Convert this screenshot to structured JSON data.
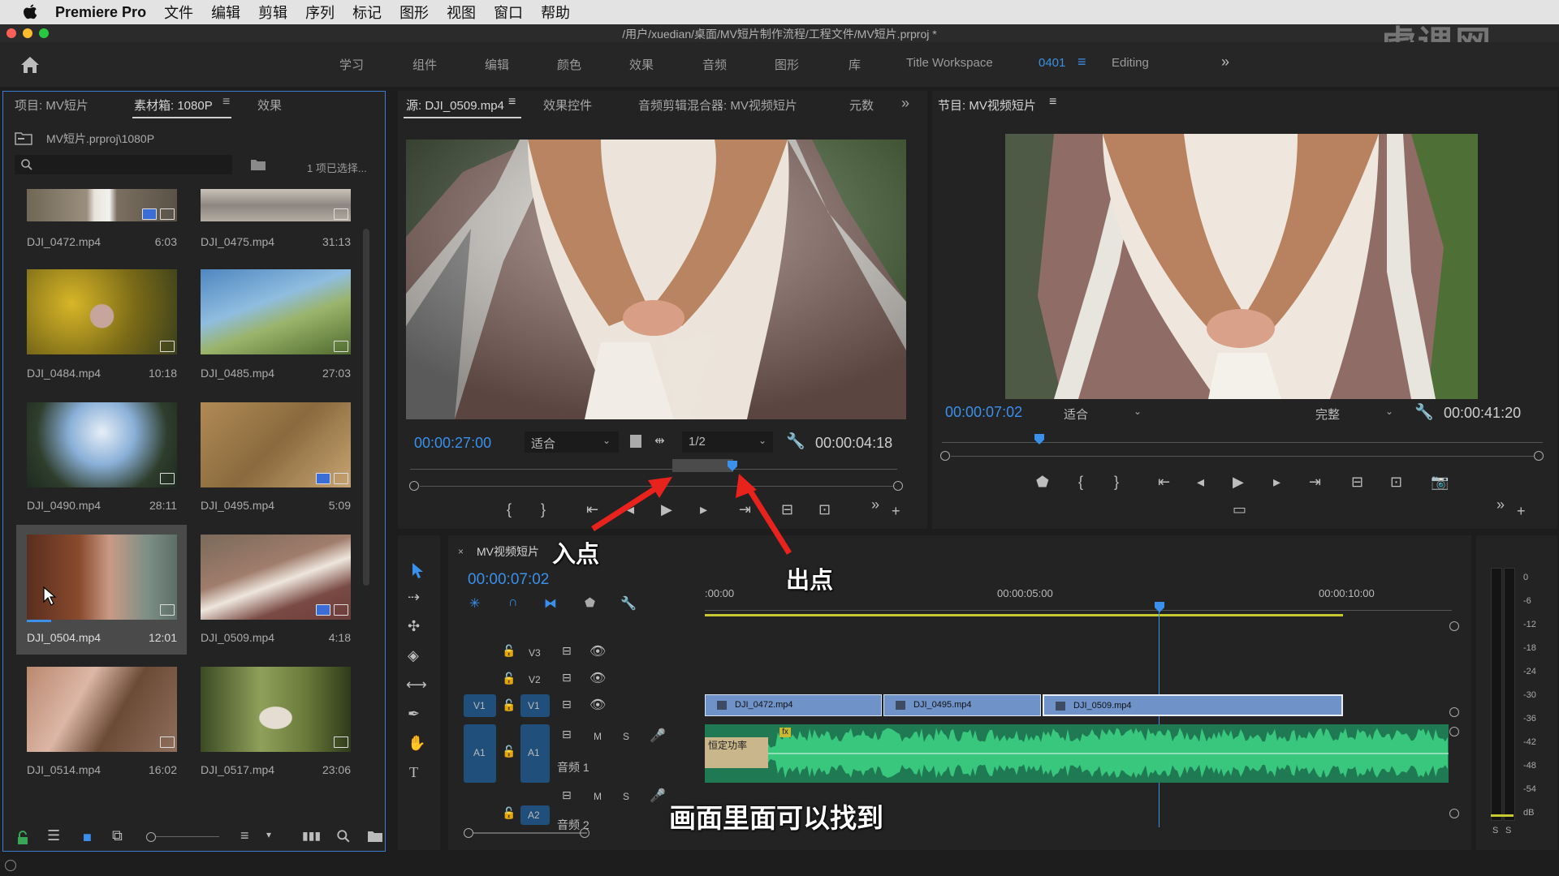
{
  "menubar": {
    "app": "Premiere Pro",
    "items": [
      "文件",
      "编辑",
      "剪辑",
      "序列",
      "标记",
      "图形",
      "视图",
      "窗口",
      "帮助"
    ]
  },
  "window": {
    "title": "/用户/xuedian/桌面/MV短片制作流程/工程文件/MV短片.prproj *"
  },
  "watermark": "虎课网",
  "workspaces": {
    "items": [
      "学习",
      "组件",
      "编辑",
      "颜色",
      "效果",
      "音频",
      "图形",
      "库",
      "Title Workspace"
    ],
    "active": "0401",
    "editing": "Editing",
    "more": "»"
  },
  "project": {
    "tabs": [
      "项目: MV短片",
      "素材箱: 1080P",
      "效果"
    ],
    "path": "MV短片.prproj\\1080P",
    "selection": "1 项已选择...",
    "items": [
      {
        "name": "DJI_0472.mp4",
        "duration": "6:03"
      },
      {
        "name": "DJI_0475.mp4",
        "duration": "31:13"
      },
      {
        "name": "DJI_0484.mp4",
        "duration": "10:18"
      },
      {
        "name": "DJI_0485.mp4",
        "duration": "27:03"
      },
      {
        "name": "DJI_0490.mp4",
        "duration": "28:11"
      },
      {
        "name": "DJI_0495.mp4",
        "duration": "5:09"
      },
      {
        "name": "DJI_0504.mp4",
        "duration": "12:01"
      },
      {
        "name": "DJI_0509.mp4",
        "duration": "4:18"
      },
      {
        "name": "DJI_0514.mp4",
        "duration": "16:02"
      },
      {
        "name": "DJI_0517.mp4",
        "duration": "23:06"
      }
    ]
  },
  "source": {
    "tabs": [
      "源: DJI_0509.mp4",
      "效果控件",
      "音频剪辑混合器: MV视频短片",
      "元数"
    ],
    "timecode": "00:00:27:00",
    "fit": "适合",
    "resolution": "1/2",
    "duration": "00:00:04:18"
  },
  "program": {
    "tab": "节目: MV视频短片",
    "timecode": "00:00:07:02",
    "fit": "适合",
    "quality": "完整",
    "duration": "00:00:41:20"
  },
  "timeline": {
    "sequence": "MV视频短片",
    "timecode": "00:00:07:02",
    "ruler": [
      ":00:00",
      "00:00:05:00",
      "00:00:10:00"
    ],
    "tracks": {
      "v3": "V3",
      "v2": "V2",
      "v1": "V1",
      "a1": "A1",
      "a2": "A2",
      "a1_name": "音频 1",
      "a2_name": "音频 2",
      "m": "M",
      "s": "S"
    },
    "clips": [
      "DJI_0472.mp4",
      "DJI_0495.mp4",
      "DJI_0509.mp4"
    ],
    "transition": "恒定功率",
    "fx": "fx"
  },
  "meter": {
    "labels": [
      "0",
      "-6",
      "-12",
      "-18",
      "-24",
      "-30",
      "-36",
      "-42",
      "-48",
      "-54",
      "dB"
    ],
    "solo": [
      "S",
      "S"
    ]
  },
  "annotations": {
    "in_point": "入点",
    "out_point": "出点"
  },
  "subtitle": "画面里面可以找到"
}
